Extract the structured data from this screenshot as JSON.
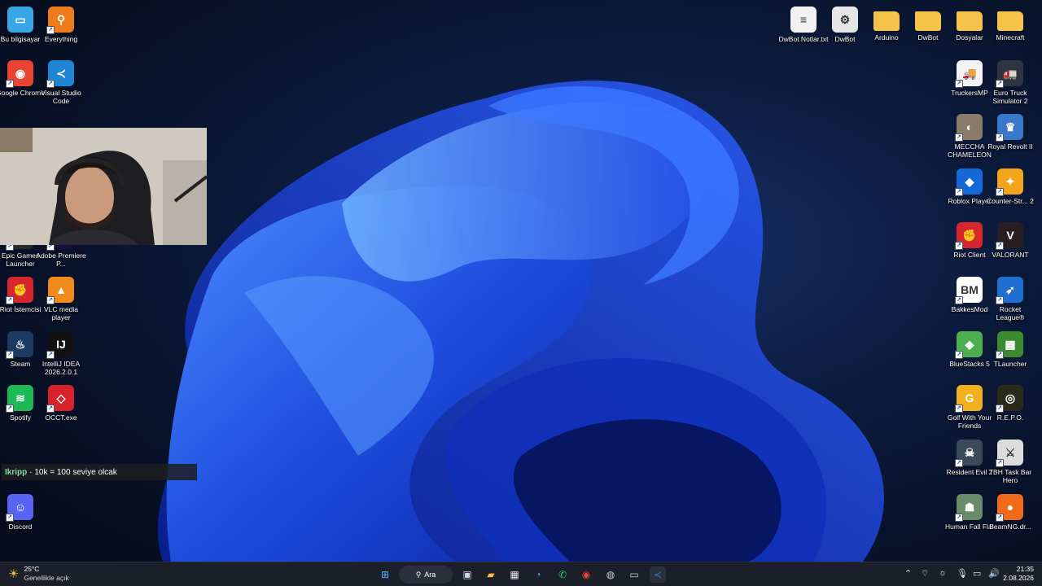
{
  "desktop": {
    "left_icons": [
      {
        "label": "Bu bilgisayar",
        "icon": "monitor-icon",
        "color": "#3aa6e8",
        "glyph": "▭"
      },
      {
        "label": "Everything",
        "icon": "everything-search-icon",
        "color": "#f07b1a",
        "glyph": "⚲"
      },
      {
        "label": "Google Chrome",
        "icon": "chrome-icon",
        "color": "#e84335",
        "glyph": "◉"
      },
      {
        "label": "Visual Studio Code",
        "icon": "vscode-icon",
        "color": "#1f86d6",
        "glyph": "≺"
      },
      {
        "label": "Epic Games Launcher",
        "icon": "epic-games-icon",
        "color": "#2a2a2a",
        "glyph": "E"
      },
      {
        "label": "Adobe Premiere P...",
        "icon": "premiere-icon",
        "color": "#1a0b40",
        "glyph": "Pr"
      },
      {
        "label": "Riot İstemcisi",
        "icon": "riot-icon",
        "color": "#d7262e",
        "glyph": "✊"
      },
      {
        "label": "VLC media player",
        "icon": "vlc-icon",
        "color": "#f08a1c",
        "glyph": "▲"
      },
      {
        "label": "Steam",
        "icon": "steam-icon",
        "color": "#1b3b63",
        "glyph": "♨"
      },
      {
        "label": "IntelliJ IDEA 2026.2.0.1",
        "icon": "intellij-icon",
        "color": "#111",
        "glyph": "IJ"
      },
      {
        "label": "Spotify",
        "icon": "spotify-icon",
        "color": "#1db954",
        "glyph": "≋"
      },
      {
        "label": "OCCT.exe",
        "icon": "occt-icon",
        "color": "#d8222b",
        "glyph": "◇"
      },
      {
        "label": "Discord",
        "icon": "discord-icon",
        "color": "#5865f2",
        "glyph": "☺"
      }
    ],
    "right_icons": [
      {
        "label": "DwBot Notlar.txt",
        "icon": "text-file-icon",
        "color": "#f2f2f2",
        "glyph": "≡"
      },
      {
        "label": "DwBot",
        "icon": "config-file-icon",
        "color": "#e6e6e6",
        "glyph": "⚙"
      },
      {
        "label": "Arduino",
        "icon": "folder-icon",
        "color": "#f5c34a",
        "glyph": ""
      },
      {
        "label": "DwBot",
        "icon": "folder-icon",
        "color": "#f5c34a",
        "glyph": ""
      },
      {
        "label": "Dosyalar",
        "icon": "folder-icon",
        "color": "#f5c34a",
        "glyph": ""
      },
      {
        "label": "Minecraft",
        "icon": "folder-icon",
        "color": "#f5c34a",
        "glyph": ""
      },
      {
        "label": "TruckersMP",
        "icon": "truckersmp-icon",
        "color": "#f3f3f3",
        "glyph": "🚚"
      },
      {
        "label": "Euro Truck Simulator 2",
        "icon": "ets2-icon",
        "color": "#2e3440",
        "glyph": "🚛"
      },
      {
        "label": "MECCHA CHAMELEON",
        "icon": "meccha-chameleon-icon",
        "color": "#8a7a6a",
        "glyph": "◐"
      },
      {
        "label": "Royal Revolt II",
        "icon": "royal-revolt-icon",
        "color": "#3a78c9",
        "glyph": "♛"
      },
      {
        "label": "Roblox Player",
        "icon": "roblox-icon",
        "color": "#1468d8",
        "glyph": "◆"
      },
      {
        "label": "Counter-Str... 2",
        "icon": "cs2-icon",
        "color": "#f2a51a",
        "glyph": "✦"
      },
      {
        "label": "Riot Client",
        "icon": "riot-client-icon",
        "color": "#d7262e",
        "glyph": "✊"
      },
      {
        "label": "VALORANT",
        "icon": "valorant-icon",
        "color": "#2a1e22",
        "glyph": "V"
      },
      {
        "label": "BakkesMod",
        "icon": "bakkesmod-icon",
        "color": "#ffffff",
        "glyph": "BM"
      },
      {
        "label": "Rocket League®",
        "icon": "rocket-league-icon",
        "color": "#1f6fd1",
        "glyph": "➶"
      },
      {
        "label": "BlueStacks 5",
        "icon": "bluestacks-icon",
        "color": "#4caf50",
        "glyph": "◈"
      },
      {
        "label": "TLauncher",
        "icon": "tlauncher-icon",
        "color": "#3c8b2e",
        "glyph": "▦"
      },
      {
        "label": "Golf With Your Friends",
        "icon": "golf-icon",
        "color": "#f2b01e",
        "glyph": "G"
      },
      {
        "label": "R.E.P.O.",
        "icon": "repo-icon",
        "color": "#2a2a1a",
        "glyph": "◎"
      },
      {
        "label": "Resident Evil 2",
        "icon": "resident-evil-icon",
        "color": "#3a4a5a",
        "glyph": "☠"
      },
      {
        "label": "TBH Task Bar Hero",
        "icon": "taskbar-hero-icon",
        "color": "#dcdcdc",
        "glyph": "⚔"
      },
      {
        "label": "Human Fall Flat",
        "icon": "human-fall-flat-icon",
        "color": "#6a8a6a",
        "glyph": "☗"
      },
      {
        "label": "BeamNG.dr...",
        "icon": "beamng-icon",
        "color": "#f06a1a",
        "glyph": "●"
      }
    ]
  },
  "chat_overlay": {
    "username": "Ikripp",
    "message": "· 10k = 100 seviye olcak"
  },
  "taskbar": {
    "weather": {
      "temperature": "25°C",
      "condition": "Genellikle açık"
    },
    "search_label": "Ara",
    "clock": {
      "time": "21:35",
      "date": "2.08.2026"
    },
    "apps": [
      {
        "name": "start-button",
        "glyph": "⊞",
        "color": "#4cc2ff"
      },
      {
        "name": "task-view-button",
        "glyph": "▣",
        "color": "#cfd6e4"
      },
      {
        "name": "file-explorer-button",
        "glyph": "▰",
        "color": "#f5c34a"
      },
      {
        "name": "microsoft-store-button",
        "glyph": "▦",
        "color": "#e8e8e8"
      },
      {
        "name": "edge-button",
        "glyph": "◔",
        "color": "#3ab0e6"
      },
      {
        "name": "whatsapp-button",
        "glyph": "✆",
        "color": "#25d366"
      },
      {
        "name": "chrome-button",
        "glyph": "◉",
        "color": "#e84335"
      },
      {
        "name": "obs-button",
        "glyph": "◍",
        "color": "#cfcfcf"
      },
      {
        "name": "terminal-button",
        "glyph": "▭",
        "color": "#cfcfcf"
      },
      {
        "name": "vscode-button",
        "glyph": "≺",
        "color": "#1f86d6"
      }
    ]
  }
}
